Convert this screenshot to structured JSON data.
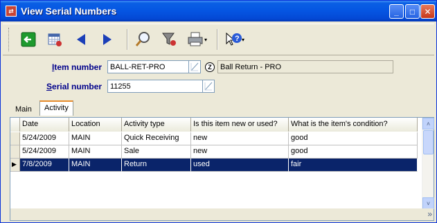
{
  "window": {
    "title": "View Serial Numbers",
    "app_icon_glyph": "⇄",
    "minimize_glyph": "_",
    "maximize_glyph": "□",
    "close_glyph": "✕"
  },
  "toolbar": {
    "buttons": [
      {
        "name": "back-exit",
        "icon": "exit-arrow-icon"
      },
      {
        "name": "calendar",
        "icon": "calendar-grid-icon"
      },
      {
        "name": "previous",
        "icon": "prev-triangle-icon"
      },
      {
        "name": "next",
        "icon": "next-triangle-icon"
      },
      {
        "name": "search",
        "icon": "magnifier-icon"
      },
      {
        "name": "filter",
        "icon": "funnel-icon"
      },
      {
        "name": "print",
        "icon": "printer-icon"
      },
      {
        "name": "help",
        "icon": "help-pointer-icon"
      }
    ],
    "dropdown_glyph": "▾"
  },
  "form": {
    "item_number_label_u": "I",
    "item_number_label_rest": "tem number",
    "item_number_value": "BALL-RET-PRO",
    "zoom_glyph": "Z",
    "item_description": "Ball Return - PRO",
    "serial_number_label_u": "S",
    "serial_number_label_rest": "erial number",
    "serial_number_value": "11255"
  },
  "tabs": [
    {
      "label": "Main",
      "active": false
    },
    {
      "label": "Activity",
      "active": true
    }
  ],
  "grid": {
    "columns": [
      "Date",
      "Location",
      "Activity type",
      "Is this item new or used?",
      "What is the item's condition?"
    ],
    "rows": [
      {
        "date": "5/24/2009",
        "location": "MAIN",
        "activity": "Quick Receiving",
        "new_used": "new",
        "condition": "good",
        "selected": false
      },
      {
        "date": "5/24/2009",
        "location": "MAIN",
        "activity": "Sale",
        "new_used": "new",
        "condition": "good",
        "selected": false
      },
      {
        "date": "7/8/2009",
        "location": "MAIN",
        "activity": "Return",
        "new_used": "used",
        "condition": "fair",
        "selected": true
      }
    ],
    "current_row_marker": "▶",
    "scroll_up_glyph": "˄",
    "scroll_down_glyph": "˅",
    "more_glyph": "»"
  },
  "colors": {
    "selection": "#0a246a",
    "label_blue": "#00008b",
    "titlebar": "#0555e2"
  }
}
